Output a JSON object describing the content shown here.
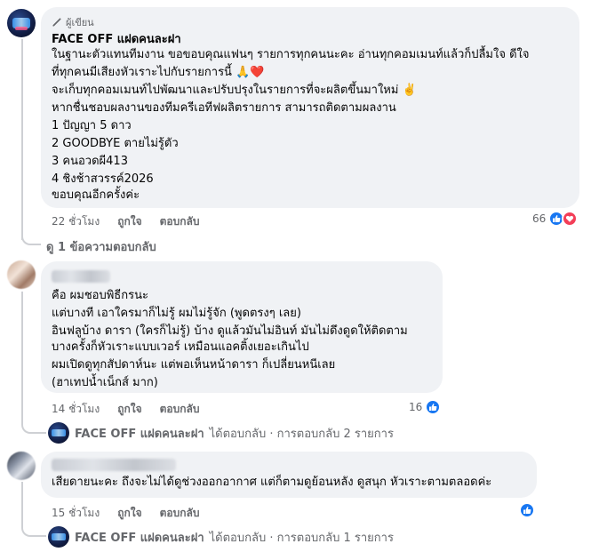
{
  "comments": [
    {
      "author_tag": "ผู้เขียน",
      "author": "FACE OFF แฝดคนละฝา",
      "lines": [
        "ในฐานะตัวแทนทีมงาน ขอขอบคุณแฟนๆ รายการทุกคนนะคะ อ่านทุกคอมเมนท์แล้วก็ปลื้มใจ ดีใจ",
        "ที่ทุกคนมีเสียงหัวเราะไปกับรายการนี้ 🙏❤️",
        "จะเก็บทุกคอมเมนท์ไปพัฒนาและปรับปรุงในรายการที่จะผลิตขึ้นมาใหม่ ✌️",
        "หากชื่นชอบผลงานของทีมครีเอทีฟผลิตรายการ สามารถติดตามผลงาน",
        "1 ปัญญา 5 ดาว",
        "2 GOODBYE ตายไม่รู้ตัว",
        "3 คนอวดผี413",
        "4 ชิงช้าสวรรค์2026",
        "ขอบคุณอีกครั้งค่ะ"
      ],
      "time": "22 ชั่วโมง",
      "like_label": "ถูกใจ",
      "reply_label": "ตอบกลับ",
      "reaction_count": "66",
      "view_replies": "ดู 1 ข้อความตอบกลับ"
    },
    {
      "lines": [
        "คือ ผมชอบพิธีกรนะ",
        "แต่บางที เอาใครมาก็ไม่รู้ ผมไม่รู้จัก (พูดตรงๆ เลย)",
        "อินฟลูบ้าง ดารา (ใครก็ไม่รู้) บ้าง ดูแล้วมันไม่อินท์ มันไม่ดึงดูดให้ติดตาม",
        "บางครั้งก็หัวเราะแบบเวอร์ เหมือนแอคติ้งเยอะเกินไป",
        "ผมเปิดดูทุกสัปดาห์นะ แต่พอเห็นหน้าดารา ก็เปลี่ยนหนีเลย",
        "(ฮาเทปน้ำเน็กส์ มาก)"
      ],
      "time": "14 ชั่วโมง",
      "like_label": "ถูกใจ",
      "reply_label": "ตอบกลับ",
      "reaction_count": "16",
      "reply_summary": {
        "name": "FACE OFF แฝดคนละฝา",
        "text": "ได้ตอบกลับ · การตอบกลับ 2 รายการ"
      }
    },
    {
      "lines": [
        "เสียดายนะคะ ถึงจะไม่ได้ดูช่วงออกอากาศ แต่ก็ตามดูย้อนหลัง ดูสนุก หัวเราะตามตลอดค่ะ"
      ],
      "time": "15 ชั่วโมง",
      "like_label": "ถูกใจ",
      "reply_label": "ตอบกลับ",
      "reaction_count": "",
      "reply_summary": {
        "name": "FACE OFF แฝดคนละฝา",
        "text": "ได้ตอบกลับ · การตอบกลับ 1 รายการ"
      }
    }
  ],
  "colors": {
    "bubble": "#f0f2f5",
    "meta_text": "#65676b",
    "like_blue": "#1877f2",
    "love_red": "#f33e58",
    "thread_line": "#ced0d4"
  },
  "icons": [
    "author-pen-icon",
    "like-reaction-icon",
    "love-reaction-icon"
  ]
}
